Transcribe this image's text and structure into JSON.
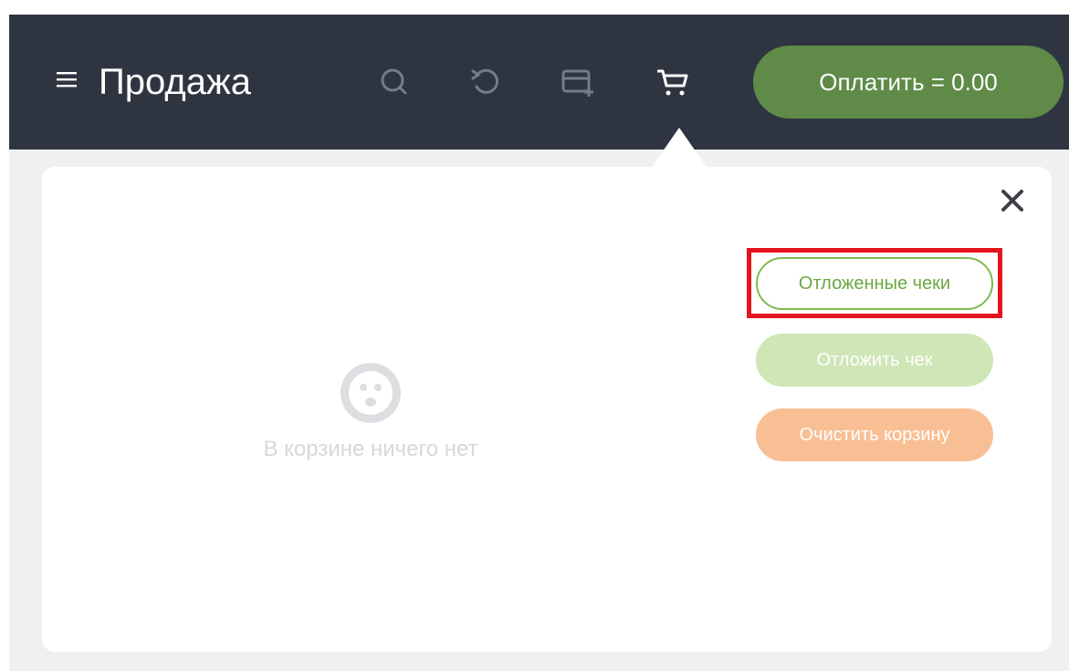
{
  "header": {
    "title": "Продажа",
    "menu_icon": "hamburger-icon",
    "icons": [
      "search-icon",
      "refresh-icon",
      "add-card-icon",
      "cart-icon"
    ],
    "pay_button_label": "Оплатить = 0.00",
    "background_color": "#2f3540",
    "pay_button_color": "#5f8a48"
  },
  "cart_panel": {
    "empty_message": "В корзине ничего нет",
    "empty_icon": "sad-face-icon",
    "close_icon": "close-icon",
    "buttons": {
      "deferred_receipts": "Отложенные чеки",
      "defer_receipt": "Отложить чек",
      "clear_cart": "Очистить корзину"
    },
    "highlight_color": "#e3141f"
  }
}
